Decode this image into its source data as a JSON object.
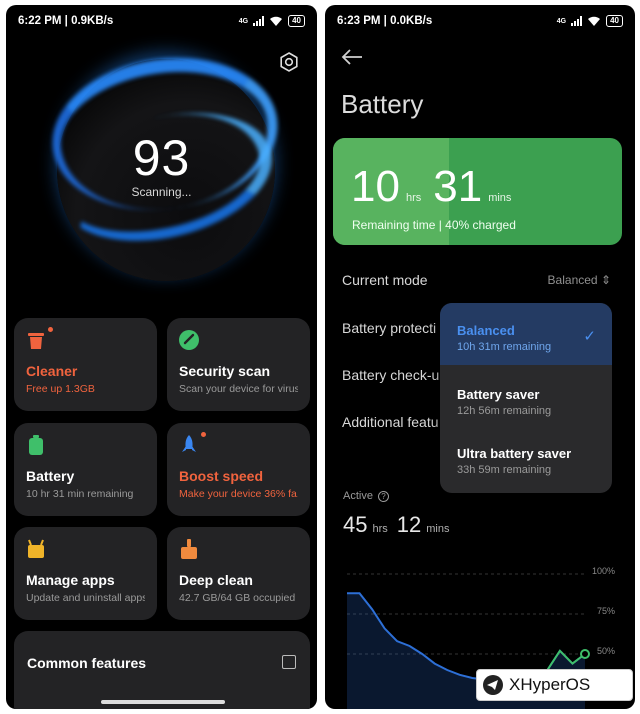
{
  "left": {
    "status": {
      "time": "6:22 PM | 0.9KB/s",
      "net": "4G",
      "battery": "40"
    },
    "score": "93",
    "scan_status": "Scanning...",
    "cards": [
      {
        "title": "Cleaner",
        "subtitle": "Free up 1.3GB",
        "icon": "trash-icon",
        "color": "#f0633e",
        "alert": true
      },
      {
        "title": "Security scan",
        "subtitle": "Scan your device for virus...",
        "icon": "shield-check-icon",
        "color": "#3fbf6a",
        "alert": false
      },
      {
        "title": "Battery",
        "subtitle": "10 hr 31 min  remaining",
        "icon": "battery-icon",
        "color": "#3fbf6a",
        "alert": false
      },
      {
        "title": "Boost speed",
        "subtitle": "Make your device 36% fa...",
        "icon": "rocket-icon",
        "color": "#3a86f0",
        "alert": true
      },
      {
        "title": "Manage apps",
        "subtitle": "Update and uninstall apps",
        "icon": "apps-icon",
        "color": "#f0b429",
        "alert": false
      },
      {
        "title": "Deep clean",
        "subtitle": "42.7 GB/64 GB occupied",
        "icon": "broom-icon",
        "color": "#f08a3e",
        "alert": false
      }
    ],
    "common_features": "Common features"
  },
  "right": {
    "status": {
      "time": "6:23 PM | 0.0KB/s",
      "net": "4G",
      "battery": "40"
    },
    "title": "Battery",
    "remaining": {
      "hours": "10",
      "hrs_unit": "hrs",
      "mins": "31",
      "mins_unit": "mins",
      "caption": "Remaining time | 40% charged",
      "charge_fraction": 0.4
    },
    "rows": {
      "current_mode": "Current mode",
      "current_mode_value": "Balanced",
      "battery_protection": "Battery protecti",
      "battery_checkup": "Battery check-u",
      "additional": "Additional featu"
    },
    "modes": [
      {
        "label": "Balanced",
        "sub": "10h 31m remaining",
        "selected": true
      },
      {
        "label": "Battery saver",
        "sub": "12h 56m remaining",
        "selected": false
      },
      {
        "label": "Ultra battery saver",
        "sub": "33h 59m remaining",
        "selected": false
      }
    ],
    "active": {
      "label": "Active",
      "hours": "45",
      "hrs_unit": "hrs",
      "mins": "12",
      "mins_unit": "mins"
    },
    "chart_data": {
      "type": "line",
      "yticks": [
        "100%",
        "75%",
        "50%"
      ],
      "ylim": [
        0,
        100
      ],
      "series": [
        {
          "values": [
            88,
            88,
            78,
            66,
            58,
            55,
            50,
            44,
            40,
            37,
            35,
            34,
            33,
            33,
            33,
            32,
            40,
            52,
            44,
            50
          ]
        }
      ],
      "colors": {
        "line": "#2d6fd6",
        "recent": "#3fbf6a"
      }
    }
  },
  "watermark": "XHyperOS"
}
